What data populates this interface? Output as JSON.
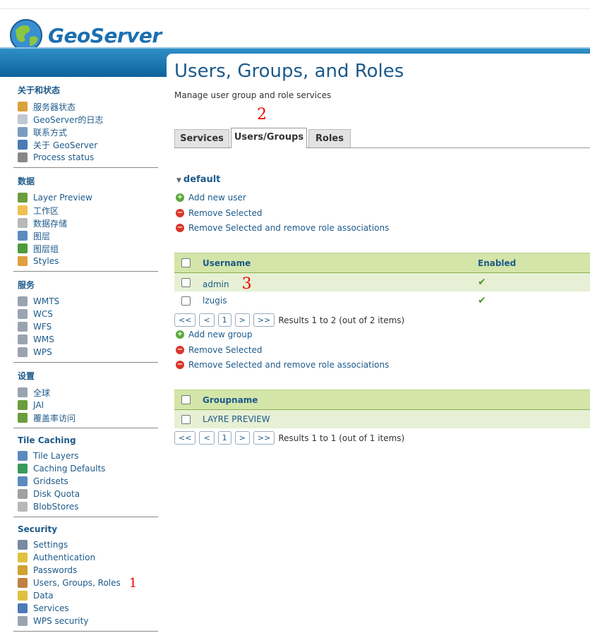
{
  "app": {
    "name": "GeoServer"
  },
  "colors": {
    "link": "#1d5a8a",
    "header_bar": "#0d5f98",
    "table_header": "#d3e5a8",
    "row_alt": "#e7f0d4",
    "add": "#5aa83a",
    "remove": "#d9352b",
    "annotation": "#e00000"
  },
  "sidebar": {
    "sections": [
      {
        "title": "关于和状态",
        "items": [
          {
            "label": "服务器状态",
            "icon": "server-status-icon"
          },
          {
            "label": "GeoServer的日志",
            "icon": "log-icon"
          },
          {
            "label": "联系方式",
            "icon": "contact-icon"
          },
          {
            "label": "关于 GeoServer",
            "icon": "about-icon"
          },
          {
            "label": "Process status",
            "icon": "gear-icon"
          }
        ]
      },
      {
        "title": "数据",
        "items": [
          {
            "label": "Layer Preview",
            "icon": "layer-preview-icon"
          },
          {
            "label": "工作区",
            "icon": "folder-icon"
          },
          {
            "label": "数据存储",
            "icon": "database-icon"
          },
          {
            "label": "图层",
            "icon": "layer-icon"
          },
          {
            "label": "图层组",
            "icon": "layer-group-icon"
          },
          {
            "label": "Styles",
            "icon": "palette-icon"
          }
        ]
      },
      {
        "title": "服务",
        "items": [
          {
            "label": "WMTS",
            "icon": "service-icon"
          },
          {
            "label": "WCS",
            "icon": "service-icon"
          },
          {
            "label": "WFS",
            "icon": "service-icon"
          },
          {
            "label": "WMS",
            "icon": "service-icon"
          },
          {
            "label": "WPS",
            "icon": "service-icon"
          }
        ]
      },
      {
        "title": "设置",
        "items": [
          {
            "label": "全球",
            "icon": "global-settings-icon"
          },
          {
            "label": "JAI",
            "icon": "jai-icon"
          },
          {
            "label": "覆盖率访问",
            "icon": "coverage-access-icon"
          }
        ]
      },
      {
        "title": "Tile Caching",
        "items": [
          {
            "label": "Tile Layers",
            "icon": "grid-icon"
          },
          {
            "label": "Caching Defaults",
            "icon": "globe-icon"
          },
          {
            "label": "Gridsets",
            "icon": "grid-icon"
          },
          {
            "label": "Disk Quota",
            "icon": "disk-icon"
          },
          {
            "label": "BlobStores",
            "icon": "database-icon"
          }
        ]
      },
      {
        "title": "Security",
        "items": [
          {
            "label": "Settings",
            "icon": "wrench-icon"
          },
          {
            "label": "Authentication",
            "icon": "shield-icon"
          },
          {
            "label": "Passwords",
            "icon": "lock-icon"
          },
          {
            "label": "Users, Groups, Roles",
            "icon": "users-icon"
          },
          {
            "label": "Data",
            "icon": "data-security-icon"
          },
          {
            "label": "Services",
            "icon": "services-security-icon"
          },
          {
            "label": "WPS security",
            "icon": "wps-security-icon"
          }
        ]
      }
    ]
  },
  "main": {
    "title": "Users, Groups, and Roles",
    "description": "Manage user group and role services",
    "tabs": [
      {
        "label": "Services",
        "active": false
      },
      {
        "label": "Users/Groups",
        "active": true
      },
      {
        "label": "Roles",
        "active": false
      }
    ],
    "service_name": "default",
    "users_actions": {
      "add": "Add new user",
      "remove": "Remove Selected",
      "remove_roles": "Remove Selected and remove role associations"
    },
    "users_table": {
      "headers": {
        "username": "Username",
        "enabled": "Enabled"
      },
      "rows": [
        {
          "username": "admin",
          "enabled": true
        },
        {
          "username": "lzugis",
          "enabled": true
        }
      ],
      "pager": {
        "first": "<<",
        "prev": "<",
        "page": "1",
        "next": ">",
        "last": ">>",
        "results": "Results 1 to 2 (out of 2 items)"
      }
    },
    "groups_actions": {
      "add": "Add new group",
      "remove": "Remove Selected",
      "remove_roles": "Remove Selected and remove role associations"
    },
    "groups_table": {
      "headers": {
        "groupname": "Groupname"
      },
      "rows": [
        {
          "groupname": "LAYRE PREVIEW"
        }
      ],
      "pager": {
        "first": "<<",
        "prev": "<",
        "page": "1",
        "next": ">",
        "last": ">>",
        "results": "Results 1 to 1 (out of 1 items)"
      }
    }
  },
  "annotations": {
    "sidebar": "1",
    "tab": "2",
    "row": "3"
  }
}
